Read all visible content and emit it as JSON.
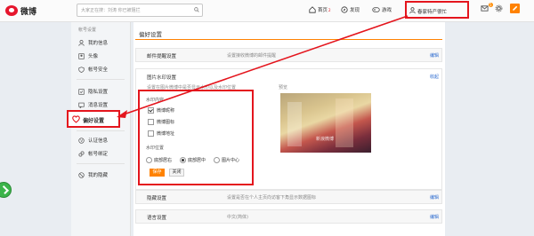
{
  "header": {
    "logo_text": "微博",
    "search_placeholder": "大家正在搜：刘涛 你已被阻拦",
    "nav": [
      {
        "label": "首页",
        "badge": "2"
      },
      {
        "label": "发现"
      },
      {
        "label": "游戏"
      }
    ],
    "user_name": "春家特产很忙",
    "msg_badge": "5"
  },
  "sidebar": {
    "head": "帐号设置",
    "items": [
      {
        "label": "我的信息",
        "icon": "person-icon"
      },
      {
        "label": "头像",
        "icon": "portrait-icon"
      },
      {
        "label": "帐号安全",
        "icon": "shield-icon"
      },
      {
        "label": "隐私设置",
        "icon": "privacy-icon"
      },
      {
        "label": "消息设置",
        "icon": "message-icon"
      },
      {
        "label": "偏好设置",
        "icon": "heart-icon",
        "active": true
      },
      {
        "label": "认证信息",
        "icon": "verify-icon"
      },
      {
        "label": "帐号绑定",
        "icon": "link-icon"
      },
      {
        "label": "我的隐藏",
        "icon": "hidden-icon"
      }
    ]
  },
  "main": {
    "title": "偏好设置",
    "rows": {
      "email": {
        "key": "邮件提醒设置",
        "value": "设置接收微博的邮件提醒",
        "action": "编辑"
      },
      "blocked": {
        "key": "隐藏设置",
        "value": "设置是否在个人主页向访客下角显示数据图标",
        "action": "编辑"
      },
      "language": {
        "key": "语言设置",
        "value": "中文(简体)",
        "action": "编辑"
      }
    },
    "watermark": {
      "title": "图片水印设置",
      "collapse": "收起",
      "desc": "设置在图片微博中是否显示水印以及水印位置",
      "preview_label": "预览",
      "watermark_text": "新浪微博",
      "type_label": "水印内容",
      "options": [
        {
          "label": "微博昵称",
          "checked": true
        },
        {
          "label": "微博图标",
          "checked": false
        },
        {
          "label": "微博地址",
          "checked": false
        }
      ],
      "position_label": "水印位置",
      "positions": [
        {
          "label": "底部居右",
          "selected": false
        },
        {
          "label": "底部居中",
          "selected": true
        },
        {
          "label": "图片中心",
          "selected": false
        }
      ],
      "save": "保存",
      "close": "关闭"
    }
  }
}
